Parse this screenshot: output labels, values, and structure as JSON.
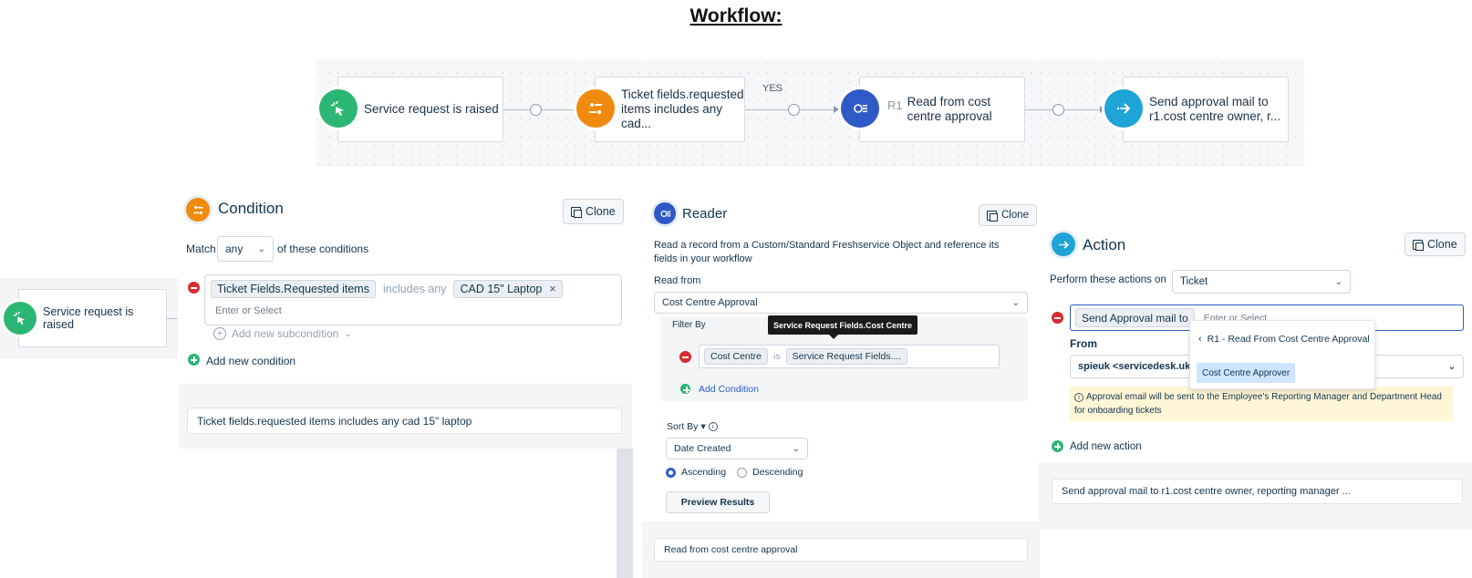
{
  "title": "Workflow:",
  "workflow": {
    "nodes": [
      {
        "label": "Service request is raised",
        "icon": "cursor-click-icon",
        "color": "#2bb673"
      },
      {
        "label": "Ticket fields.requested items includes any cad...",
        "icon": "condition-icon",
        "color": "#f08a0e"
      },
      {
        "prefix": "R1",
        "label": "Read from cost centre approval",
        "icon": "reader-icon",
        "color": "#2f59c7"
      },
      {
        "label": "Send approval mail to r1.cost centre owner, r...",
        "icon": "action-arrow-icon",
        "color": "#1ea4d6"
      }
    ],
    "yes_label": "YES"
  },
  "side_node": {
    "label": "Service request is raised"
  },
  "condition": {
    "title": "Condition",
    "clone": "Clone",
    "match_label": "Match",
    "match_value": "any",
    "match_suffix": "of these conditions",
    "field_chip": "Ticket Fields.Requested items",
    "operator": "includes any",
    "value_chip": "CAD 15\" Laptop",
    "input_placeholder": "Enter or Select",
    "add_subcondition": "Add new subcondition",
    "add_condition": "Add new condition",
    "summary": "Ticket fields.requested items includes any cad 15\" laptop"
  },
  "reader": {
    "title": "Reader",
    "clone": "Clone",
    "description": "Read a record from a Custom/Standard Freshservice Object and reference its fields in your workflow",
    "read_from_label": "Read from",
    "read_from_value": "Cost Centre Approval",
    "filter_by": "Filter By",
    "tooltip": "Service Request Fields.Cost Centre",
    "filter_field": "Cost Centre",
    "filter_op": "is",
    "filter_value": "Service Request Fields....",
    "add_condition": "Add Condition",
    "sort_by": "Sort By",
    "sort_value": "Date Created",
    "ascending": "Ascending",
    "descending": "Descending",
    "preview": "Preview Results",
    "summary": "Read from cost centre approval"
  },
  "action": {
    "title": "Action",
    "clone": "Clone",
    "perform_label": "Perform these actions on",
    "perform_value": "Ticket",
    "action_chip": "Send Approval mail to",
    "input_placeholder": "Enter or Select",
    "dropdown_header": "R1 - Read From Cost Centre Approval",
    "dropdown_option": "Cost Centre Approver",
    "from_label": "From",
    "from_value": "spieuk <servicedesk.uk@",
    "info": "Approval email will be sent to the Employee's Reporting Manager and Department Head for onboarding tickets",
    "add_action": "Add new action",
    "summary": "Send approval mail to r1.cost centre owner, reporting manager ..."
  }
}
